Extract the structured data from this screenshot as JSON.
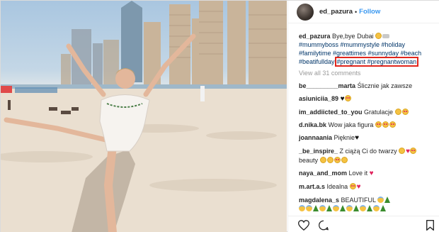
{
  "post": {
    "username": "ed_pazura",
    "follow_label": "Follow",
    "dot": "•",
    "caption": {
      "username": "ed_pazura",
      "text": "Bye,bye Dubai",
      "tags_line1": "#mummyboss #mummystyle #holiday",
      "tags_line2": "#familytime #greattimes #sunnyday #beach",
      "tag_beach_full": "#beatifullday",
      "tag_highlight": "#pregnant #pregnantwoman"
    },
    "view_all": "View all 31 comments",
    "comments": [
      {
        "user": "be_________marta",
        "text": "Ślicznie jak zawsze"
      },
      {
        "user": "asiuniciia_89",
        "text": ""
      },
      {
        "user": "im_addiicted_to_you",
        "text": "Gratulacje"
      },
      {
        "user": "d.nika.bk",
        "text": "Wow jaka figura"
      },
      {
        "user": "joannaania",
        "text": "Pięknie"
      },
      {
        "user": "_be_inspire_",
        "text": "Z ciążą Ci do twarzy"
      },
      {
        "user": "",
        "text": "beauty"
      },
      {
        "user": "naya_and_mom",
        "text": "Love it"
      },
      {
        "user": "m.art.a.s",
        "text": "Idealna"
      },
      {
        "user": "magdalena_s",
        "text": "BEAUTIFUL"
      }
    ]
  },
  "icons": {
    "like": "heart-outline-icon",
    "comment": "comment-bubble-icon",
    "save": "bookmark-icon"
  },
  "colors": {
    "link_blue": "#3897f0",
    "hashtag": "#003569",
    "highlight_box": "#e1261c",
    "heart_red": "#e0245e"
  }
}
